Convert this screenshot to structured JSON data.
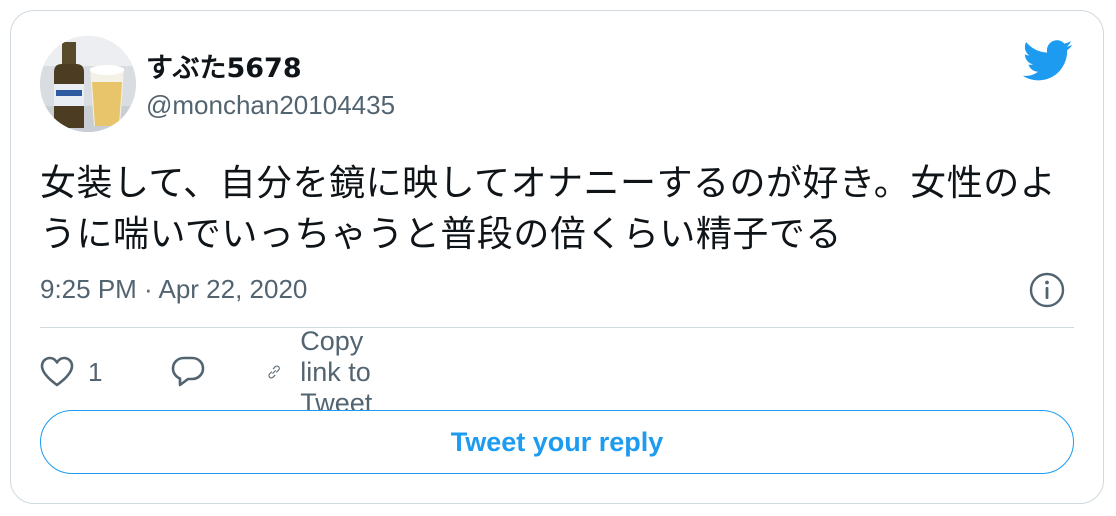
{
  "author": {
    "name": "すぶた5678",
    "handle": "@monchan20104435"
  },
  "tweet": {
    "text": "女装して、自分を鏡に映してオナニーするのが好き。女性のように喘いでいっちゃうと普段の倍くらい精子でる",
    "timestamp": "9:25 PM · Apr 22, 2020"
  },
  "actions": {
    "like_count": "1",
    "copy_link_label": "Copy link to Tweet"
  },
  "reply_button_label": "Tweet your reply",
  "icons": [
    "twitter-bird-icon",
    "info-icon",
    "heart-icon",
    "reply-bubble-icon",
    "link-icon"
  ],
  "colors": {
    "accent": "#1d9bf0",
    "text_primary": "#0f1419",
    "text_secondary": "#536471",
    "border": "#cfd9de"
  }
}
